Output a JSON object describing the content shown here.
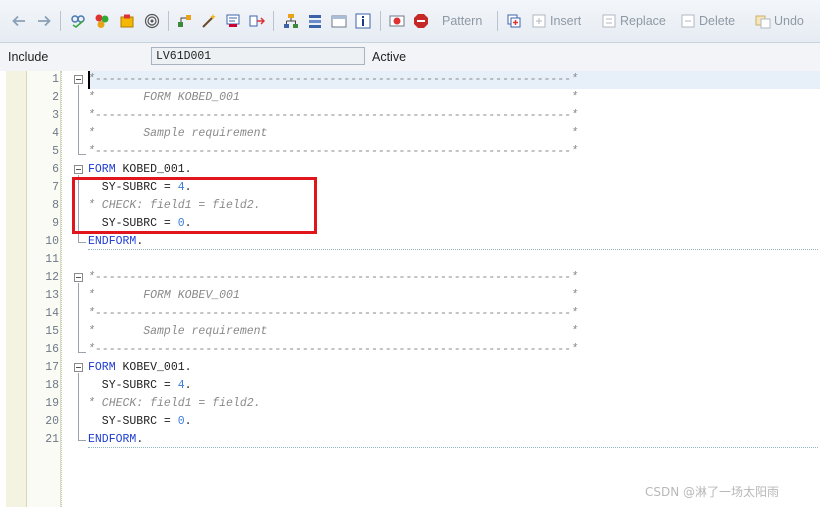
{
  "toolbar": {
    "icons": [
      "back-arrow-icon",
      "forward-arrow-icon",
      "other-object-icon",
      "check-icon",
      "activate-icon",
      "where-used-icon",
      "display-object-list-icon",
      "magic-wand-icon",
      "pretty-printer-icon",
      "navigation-icon",
      "hierarchy-icon",
      "stack-icon",
      "window-icon",
      "info-icon",
      "breakpoint-icon",
      "stop-icon"
    ],
    "pattern_label": "Pattern",
    "insert_label": "Insert",
    "replace_label": "Replace",
    "delete_label": "Delete",
    "undo_label": "Undo"
  },
  "header": {
    "include_label": "Include",
    "include_value": "LV61D001",
    "status": "Active"
  },
  "editor": {
    "lines": [
      {
        "n": "1",
        "text": "*---------------------------------------------------------------------*"
      },
      {
        "n": "2",
        "text": "*       FORM KOBED_001                                                *"
      },
      {
        "n": "3",
        "text": "*---------------------------------------------------------------------*"
      },
      {
        "n": "4",
        "text": "*       Sample requirement                                            *"
      },
      {
        "n": "5",
        "text": "*---------------------------------------------------------------------*"
      },
      {
        "n": "6",
        "kw": "FORM",
        "rest": " KOBED_001."
      },
      {
        "n": "7",
        "pre": "  SY-SUBRC = ",
        "num": "4",
        "post": "."
      },
      {
        "n": "8",
        "text": "* CHECK: field1 = field2."
      },
      {
        "n": "9",
        "pre": "  SY-SUBRC = ",
        "num": "0",
        "post": "."
      },
      {
        "n": "10",
        "kw": "ENDFORM",
        "rest": "."
      },
      {
        "n": "11"
      },
      {
        "n": "12",
        "text": "*---------------------------------------------------------------------*"
      },
      {
        "n": "13",
        "text": "*       FORM KOBEV_001                                                *"
      },
      {
        "n": "14",
        "text": "*---------------------------------------------------------------------*"
      },
      {
        "n": "15",
        "text": "*       Sample requirement                                            *"
      },
      {
        "n": "16",
        "text": "*---------------------------------------------------------------------*"
      },
      {
        "n": "17",
        "kw": "FORM",
        "rest": " KOBEV_001."
      },
      {
        "n": "18",
        "pre": "  SY-SUBRC = ",
        "num": "4",
        "post": "."
      },
      {
        "n": "19",
        "text": "* CHECK: field1 = field2."
      },
      {
        "n": "20",
        "pre": "  SY-SUBRC = ",
        "num": "0",
        "post": "."
      },
      {
        "n": "21",
        "kw": "ENDFORM",
        "rest": "."
      }
    ]
  },
  "watermark": "CSDN @淋了一场太阳雨",
  "colors": {
    "keyword": "#1f3fd1",
    "number": "#3b7fd8",
    "comment": "#8a8a8a",
    "highlight_box": "#e0161c"
  }
}
